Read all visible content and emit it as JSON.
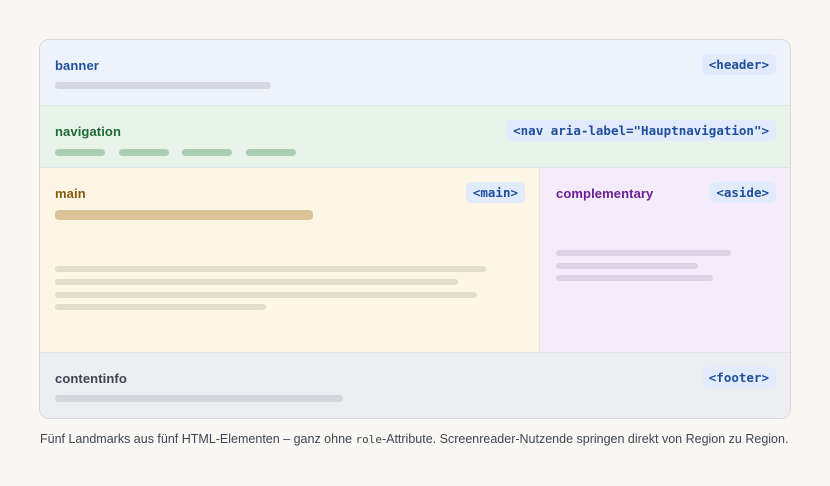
{
  "regions": {
    "banner": {
      "label": "banner",
      "tag": "<header>"
    },
    "navigation": {
      "label": "navigation",
      "tag": "<nav aria-label=\"Hauptnavigation\">"
    },
    "main": {
      "label": "main",
      "tag": "<main>"
    },
    "complementary": {
      "label": "complementary",
      "tag": "<aside>"
    },
    "contentinfo": {
      "label": "contentinfo",
      "tag": "<footer>"
    }
  },
  "caption": {
    "before": "Fünf Landmarks aus fünf HTML-Elementen – ganz ohne ",
    "code": "role",
    "after": "-Attribute. Screenreader-Nutzende springen direkt von Region zu Region."
  },
  "colors": {
    "banner_bg": "#edf3fd",
    "navigation_bg": "#e8f3ea",
    "main_bg": "#fdf6e6",
    "complementary_bg": "#f5ecfb",
    "contentinfo_bg": "#eceef1",
    "tag_text": "#1f4e9c"
  }
}
